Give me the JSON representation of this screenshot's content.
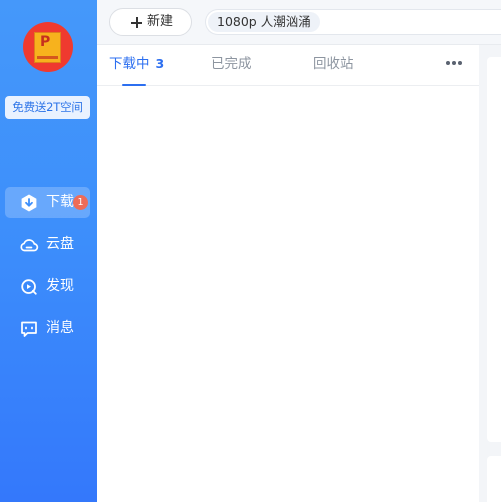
{
  "sidebar": {
    "avatar_icon": "app-logo-icon",
    "promo_label": "免费送2T空间",
    "items": [
      {
        "label": "下载",
        "icon": "download-icon",
        "active": true,
        "badge": "1"
      },
      {
        "label": "云盘",
        "icon": "cloud-icon",
        "active": false
      },
      {
        "label": "发现",
        "icon": "discover-icon",
        "active": false
      },
      {
        "label": "消息",
        "icon": "message-icon",
        "active": false
      }
    ]
  },
  "toolbar": {
    "new_label": "新建",
    "search_text": "1080p 人潮汹涌"
  },
  "tabs": [
    {
      "label": "下载中",
      "count": "3",
      "active": true
    },
    {
      "label": "已完成",
      "active": false
    },
    {
      "label": "回收站",
      "active": false
    }
  ],
  "colors": {
    "sidebar_top": "#4598fa",
    "sidebar_bottom": "#3478fb",
    "accent": "#2c6ff0",
    "badge": "#ee6c59",
    "avatar": "#ef3a2f"
  }
}
